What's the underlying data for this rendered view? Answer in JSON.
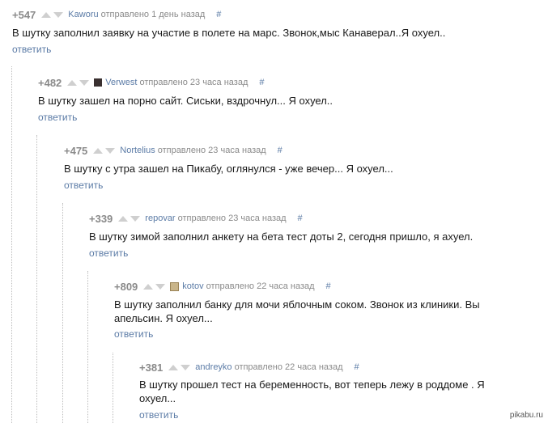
{
  "comments": [
    {
      "rating": "+547",
      "author": "Kaworu",
      "sent": "отправлено 1 день назад",
      "hash": "#",
      "text": "В шутку заполнил заявку на участие в полете на марс. Звонок,мыс Канаверал..Я охуел..",
      "reply": "ответить",
      "avatar": null
    },
    {
      "rating": "+482",
      "author": "Verwest",
      "sent": "отправлено 23 часа назад",
      "hash": "#",
      "text": "В шутку зашел на порно сайт. Сиськи, вздрочнул... Я охуел..",
      "reply": "ответить",
      "avatar": "dark"
    },
    {
      "rating": "+475",
      "author": "Nortelius",
      "sent": "отправлено 23 часа назад",
      "hash": "#",
      "text": "В шутку с утра зашел на Пикабу, оглянулся - уже вечер... Я охуел...",
      "reply": "ответить",
      "avatar": null
    },
    {
      "rating": "+339",
      "author": "repovar",
      "sent": "отправлено 23 часа назад",
      "hash": "#",
      "text": "В шутку зимой заполнил анкету на бета тест доты 2, сегодня пришло, я ахуел.",
      "reply": "ответить",
      "avatar": null
    },
    {
      "rating": "+809",
      "author": "kotov",
      "sent": "отправлено 22 часа назад",
      "hash": "#",
      "text": "В шутку заполнил банку для мочи яблочным соком. Звонок из клиники. Вы апельсин. Я охуел...",
      "reply": "ответить",
      "avatar": "cat"
    },
    {
      "rating": "+381",
      "author": "andreyko",
      "sent": "отправлено 22 часа назад",
      "hash": "#",
      "text": "В шутку прошел тест на беременность, вот теперь лежу в роддоме . Я охуел...",
      "reply": "ответить",
      "avatar": null
    }
  ],
  "watermark": "pikabu.ru",
  "colors": {
    "link": "#5b7ba6",
    "rating": "#8a8a8a",
    "text": "#1a1a1a"
  }
}
